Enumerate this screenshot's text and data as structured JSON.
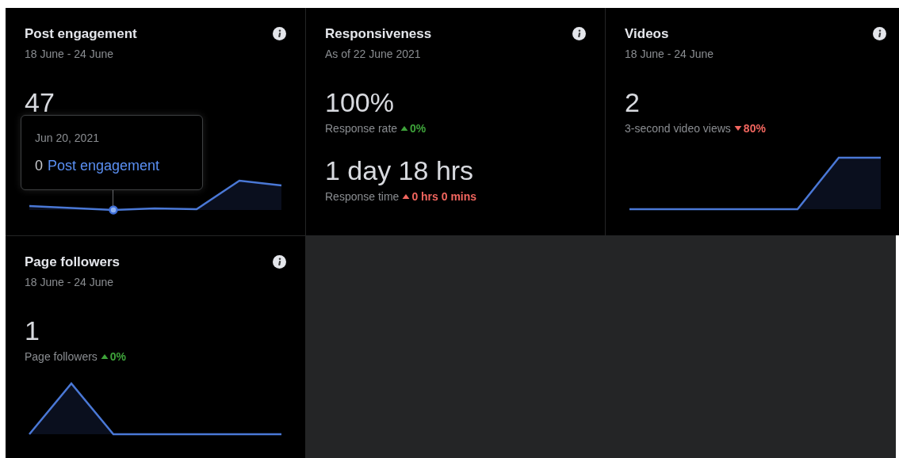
{
  "cards": [
    {
      "title": "Post engagement",
      "subtitle": "18 June - 24 June",
      "metrics": [
        {
          "value": "47"
        }
      ],
      "chart": {
        "kind": "picture"
      },
      "tooltip": {
        "date": "Jun 20, 2021",
        "count": "0",
        "label": "Post engagement"
      }
    },
    {
      "title": "Responsiveness",
      "subtitle": "As of 22 June 2021",
      "metrics": [
        {
          "value": "100%",
          "label": "Response rate",
          "change": {
            "increase": true,
            "favorable": true,
            "text": "0%"
          }
        },
        {
          "value": "1 day 18 hrs",
          "label": "Response time",
          "change": {
            "increase": true,
            "favorable": false,
            "text": "0 hrs 0 mins"
          }
        }
      ]
    },
    {
      "title": "Videos",
      "subtitle": "18 June - 24 June",
      "metrics": [
        {
          "value": "2",
          "label": "3-second video views",
          "change": {
            "increase": false,
            "favorable": false,
            "text": "80%"
          }
        }
      ],
      "chart": {
        "kind": "picture"
      }
    },
    {
      "title": "Page followers",
      "subtitle": "18 June - 24 June",
      "metrics": [
        {
          "value": "1",
          "label": "Page followers",
          "change": {
            "increase": true,
            "favorable": true,
            "text": "0%"
          }
        }
      ],
      "chart": {
        "kind": "picture"
      }
    }
  ]
}
